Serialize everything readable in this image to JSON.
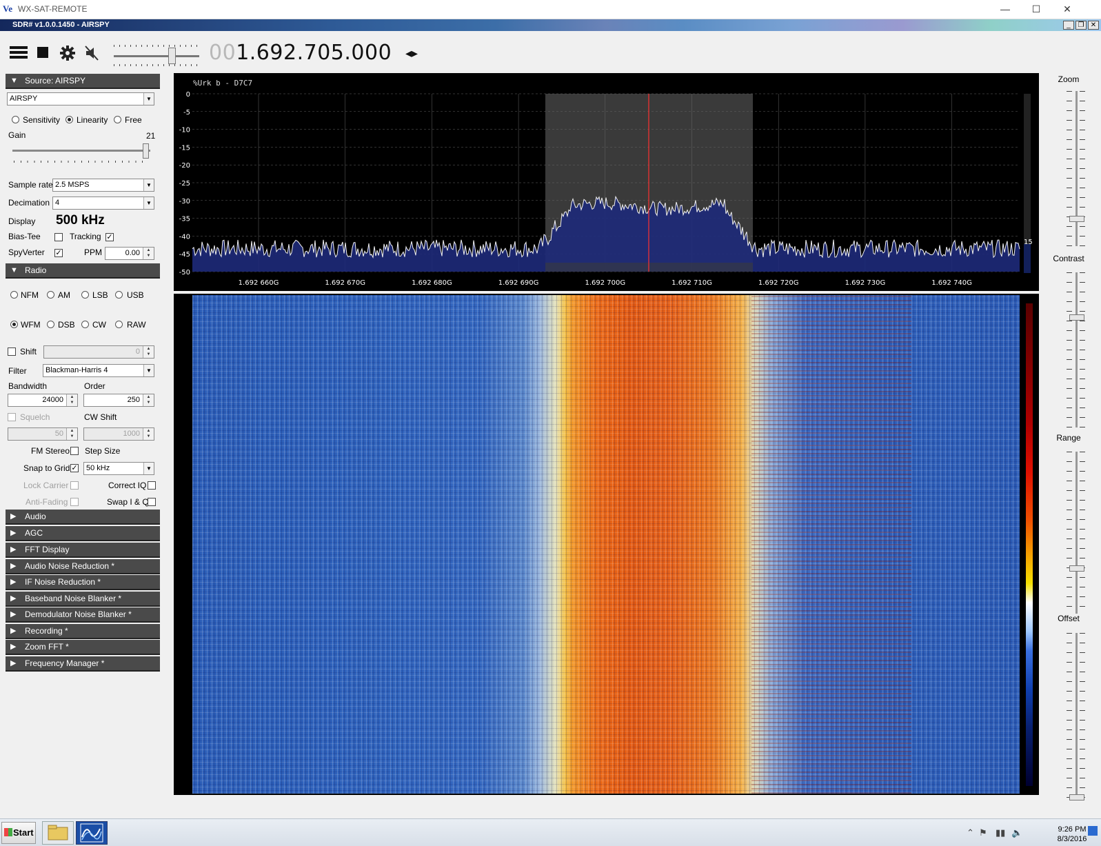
{
  "outer_window": {
    "title": "WX-SAT-REMOTE",
    "icon_text": "Ve",
    "minimize": "—",
    "maximize": "☐",
    "close": "✕"
  },
  "inner_window": {
    "title": "SDR# v1.0.0.1450 - AIRSPY",
    "min": "_",
    "restore": "❐",
    "close": "✕"
  },
  "toolbar": {
    "frequency_dim": "00",
    "frequency_lit": "1.692.705.000",
    "arrows": "◂▸"
  },
  "source": {
    "header": "Source: AIRSPY",
    "device": "AIRSPY",
    "modes": [
      "Sensitivity",
      "Linearity",
      "Free"
    ],
    "selected_mode": "Linearity",
    "gain_label": "Gain",
    "gain_value": "21",
    "sample_rate_label": "Sample rate",
    "sample_rate": "2.5 MSPS",
    "decimation_label": "Decimation",
    "decimation": "4",
    "display_label": "Display",
    "display_value": "500 kHz",
    "bias_tee_label": "Bias-Tee",
    "tracking_label": "Tracking",
    "spyverter_label": "SpyVerter",
    "ppm_label": "PPM",
    "ppm_value": "0.00"
  },
  "radio": {
    "header": "Radio",
    "modes_row1": [
      "NFM",
      "AM",
      "LSB",
      "USB"
    ],
    "modes_row2": [
      "WFM",
      "DSB",
      "CW",
      "RAW"
    ],
    "selected_mode": "WFM",
    "shift_label": "Shift",
    "shift_value": "0",
    "filter_label": "Filter",
    "filter_value": "Blackman-Harris 4",
    "bandwidth_label": "Bandwidth",
    "bandwidth_value": "24000",
    "order_label": "Order",
    "order_value": "250",
    "squelch_label": "Squelch",
    "squelch_value": "50",
    "cw_shift_label": "CW Shift",
    "cw_shift_value": "1000",
    "fm_stereo_label": "FM Stereo",
    "step_size_label": "Step Size",
    "snap_label": "Snap to Grid",
    "step_size_value": "50 kHz",
    "lock_carrier_label": "Lock Carrier",
    "correct_iq_label": "Correct IQ",
    "anti_fading_label": "Anti-Fading",
    "swap_iq_label": "Swap I & Q"
  },
  "collapsed_sections": [
    "Audio",
    "AGC",
    "FFT Display",
    "Audio Noise Reduction *",
    "IF Noise Reduction *",
    "Baseband Noise Blanker *",
    "Demodulator Noise Blanker *",
    "Recording *",
    "Zoom FFT *",
    "Frequency Manager *"
  ],
  "spectrum": {
    "overlay_text": "%Urk  b - D7C7",
    "y_ticks": [
      "0",
      "-5",
      "-10",
      "-15",
      "-20",
      "-25",
      "-30",
      "-35",
      "-40",
      "-45",
      "-50"
    ],
    "x_ticks": [
      "1.692 660G",
      "1.692 670G",
      "1.692 680G",
      "1.692 690G",
      "1.692 700G",
      "1.692 710G",
      "1.692 720G",
      "1.692 730G",
      "1.692 740G"
    ],
    "side_value": "15"
  },
  "right_controls": {
    "zoom": "Zoom",
    "contrast": "Contrast",
    "range": "Range",
    "offset": "Offset"
  },
  "taskbar": {
    "start": "Start",
    "time": "9:26 PM",
    "date": "8/3/2016"
  },
  "colors": {
    "section_header": "#4a4a4a",
    "spectrum_bg": "#000000",
    "waterfall_signal": "#e45a12",
    "waterfall_noise": "#2c5eb8",
    "marker": "#ff3030"
  }
}
